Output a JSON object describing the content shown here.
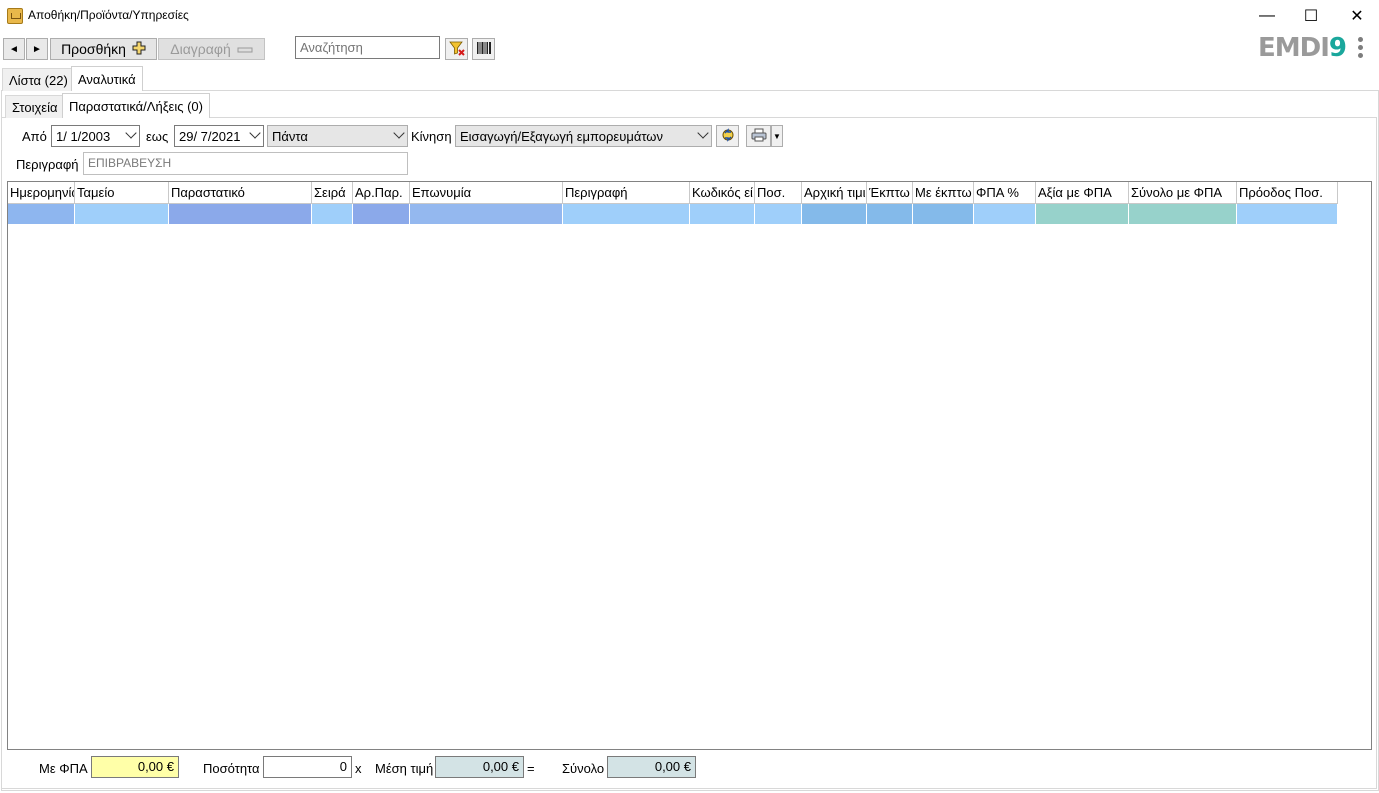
{
  "window": {
    "title": "Αποθήκη/Προϊόντα/Υπηρεσίες",
    "minimize": "—",
    "maximize": "☐",
    "close": "✕"
  },
  "toolbar": {
    "prev": "◄",
    "next": "►",
    "add_label": "Προσθήκη",
    "delete_label": "Διαγραφή",
    "search_placeholder": "Αναζήτηση",
    "logo_text": "EMDI",
    "logo_nine": "9"
  },
  "tabs": {
    "outer": [
      {
        "label": "Λίστα (22)"
      },
      {
        "label": "Αναλυτικά"
      }
    ],
    "inner": [
      {
        "label": "Στοιχεία"
      },
      {
        "label": "Παραστατικά/Λήξεις (0)"
      }
    ]
  },
  "filters": {
    "from_label": "Από",
    "from_date": "1/ 1/2003",
    "to_label": "εως",
    "to_date": "29/ 7/2021",
    "period": "Πάντα",
    "movement_label": "Κίνηση",
    "movement": "Εισαγωγή/Εξαγωγή εμπορευμάτων",
    "description_label": "Περιγραφή",
    "description_value": "ΕΠΙΒΡΑΒΕΥΣΗ"
  },
  "grid": {
    "columns": [
      {
        "label": "Ημερομηνία",
        "color": "#8eb6ef"
      },
      {
        "label": "Ταμείο",
        "color": "#9fcffa"
      },
      {
        "label": "Παραστατικό",
        "color": "#8ba9ea"
      },
      {
        "label": "Σειρά",
        "color": "#9fcffa"
      },
      {
        "label": "Αρ.Παρ.",
        "color": "#8ba9ea"
      },
      {
        "label": "Επωνυμία",
        "color": "#94b8ef"
      },
      {
        "label": "Περιγραφή",
        "color": "#9fcffa"
      },
      {
        "label": "Κωδικός εί",
        "color": "#9fcffa"
      },
      {
        "label": "Ποσ.",
        "color": "#9fcffa"
      },
      {
        "label": "Αρχική τιμι",
        "color": "#84baea"
      },
      {
        "label": "Έκπτω",
        "color": "#84baea"
      },
      {
        "label": "Με έκπτω",
        "color": "#84baea"
      },
      {
        "label": "ΦΠΑ %",
        "color": "#9fcffa"
      },
      {
        "label": "Αξία με ΦΠΑ",
        "color": "#97d2cb"
      },
      {
        "label": "Σύνολο με ΦΠΑ",
        "color": "#97d2cb"
      },
      {
        "label": "Πρόοδος Ποσ.",
        "color": "#9fcffa"
      }
    ]
  },
  "footer": {
    "vat_label": "Με ΦΠΑ",
    "vat_value": "0,00 €",
    "qty_label": "Ποσότητα",
    "qty_value": "0",
    "times": "x",
    "avg_label": "Μέση τιμή",
    "avg_value": "0,00 €",
    "equals": "=",
    "total_label": "Σύνολο",
    "total_value": "0,00 €"
  }
}
